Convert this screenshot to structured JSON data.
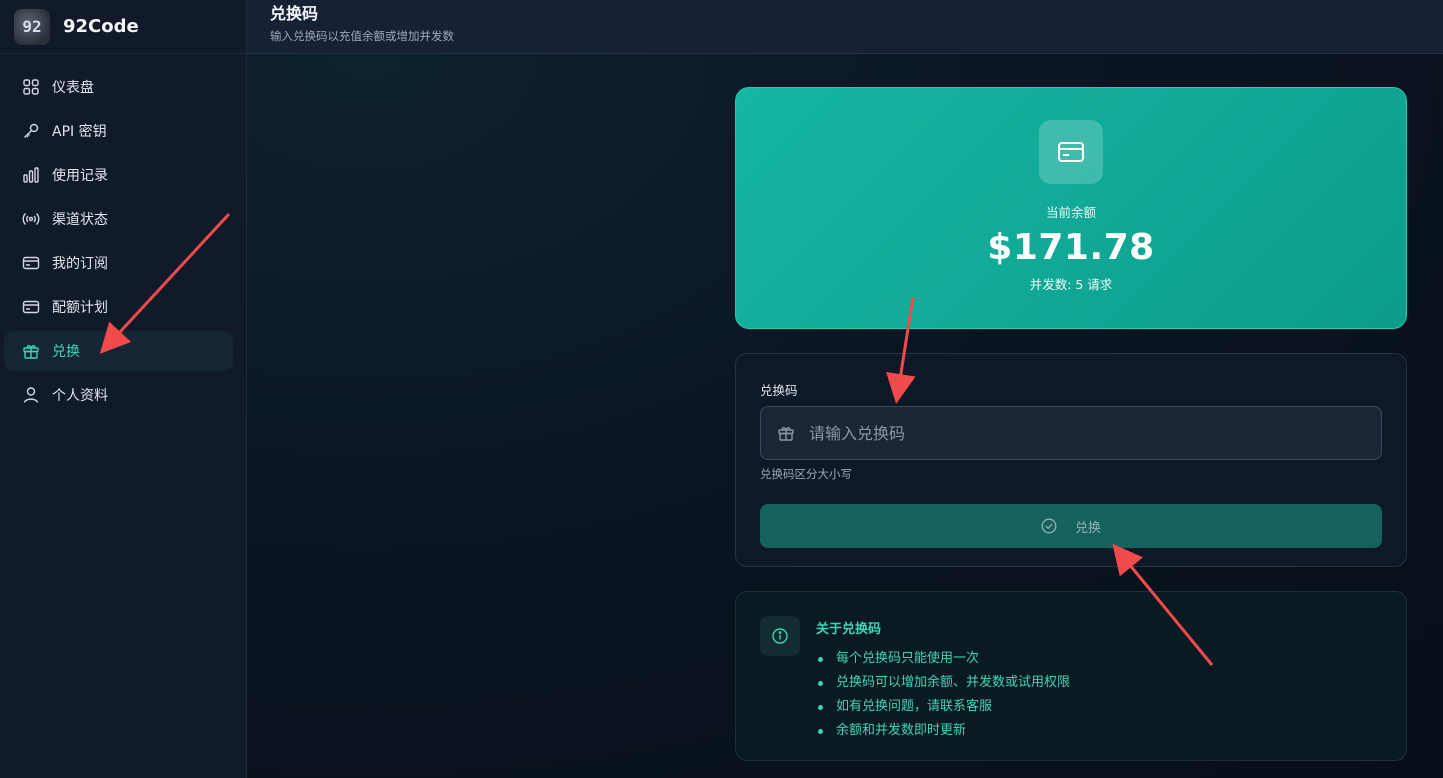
{
  "brand": {
    "logo_text": "92",
    "name": "92Code"
  },
  "sidebar": {
    "items": [
      {
        "label": "仪表盘",
        "icon": "grid-icon"
      },
      {
        "label": "API 密钥",
        "icon": "key-icon"
      },
      {
        "label": "使用记录",
        "icon": "bar-chart-icon"
      },
      {
        "label": "渠道状态",
        "icon": "broadcast-icon"
      },
      {
        "label": "我的订阅",
        "icon": "credit-card-icon"
      },
      {
        "label": "配额计划",
        "icon": "credit-card-icon"
      },
      {
        "label": "兑换",
        "icon": "gift-icon",
        "active": true
      },
      {
        "label": "个人资料",
        "icon": "user-icon"
      }
    ]
  },
  "header": {
    "title": "兑换码",
    "subtitle": "输入兑换码以充值余额或增加并发数"
  },
  "balance": {
    "label": "当前余额",
    "value": "$171.78",
    "concurrency": "并发数: 5 请求"
  },
  "redeem": {
    "field_label": "兑换码",
    "placeholder": "请输入兑换码",
    "value": "",
    "hint": "兑换码区分大小写",
    "button_label": "兑换"
  },
  "info": {
    "title": "关于兑换码",
    "items": [
      "每个兑换码只能使用一次",
      "兑换码可以增加余额、并发数或试用权限",
      "如有兑换问题，请联系客服",
      "余额和并发数即时更新"
    ]
  },
  "colors": {
    "accent": "#3fd4b7",
    "balance_card": "#12ab98",
    "annotation_arrow": "#ef4b4b"
  }
}
